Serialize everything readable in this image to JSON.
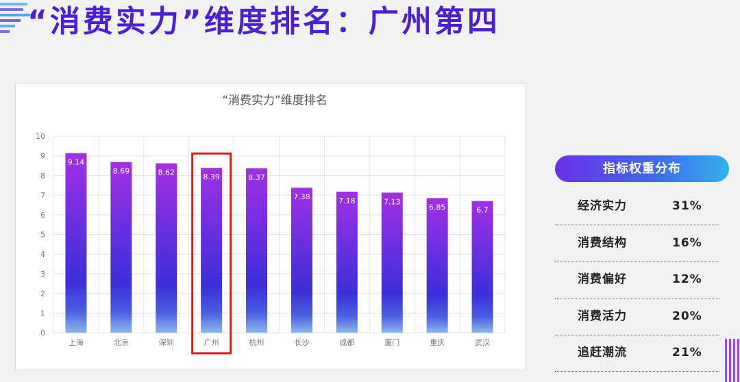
{
  "page_title": "“消费实力”维度排名：广州第四",
  "chart_data": {
    "type": "bar",
    "title": "“消费实力”维度排名",
    "categories": [
      "上海",
      "北京",
      "深圳",
      "广州",
      "杭州",
      "长沙",
      "成都",
      "厦门",
      "重庆",
      "武汉"
    ],
    "values": [
      9.14,
      8.69,
      8.62,
      8.39,
      8.37,
      7.38,
      7.18,
      7.13,
      6.85,
      6.7
    ],
    "value_labels": [
      "9.14",
      "8.69",
      "8.62",
      "8.39",
      "8.37",
      "7.38",
      "7.18",
      "7.13",
      "6.85",
      "6.7"
    ],
    "ylim": [
      0,
      10
    ],
    "yticks": [
      "0",
      "1",
      "2",
      "3",
      "4",
      "5",
      "6",
      "7",
      "8",
      "9",
      "10"
    ],
    "grid": true,
    "highlight_category": "广州",
    "highlight_color": "#e8141c",
    "bar_gradient": [
      "#a22fe6",
      "#3b2fd8",
      "#8ab8ec"
    ]
  },
  "weights": {
    "header": "指标权重分布",
    "rows": [
      {
        "name": "经济实力",
        "value": "31%"
      },
      {
        "name": "消费结构",
        "value": "16%"
      },
      {
        "name": "消费偏好",
        "value": "12%"
      },
      {
        "name": "消费活力",
        "value": "20%"
      },
      {
        "name": "追赶潮流",
        "value": "21%"
      }
    ]
  }
}
